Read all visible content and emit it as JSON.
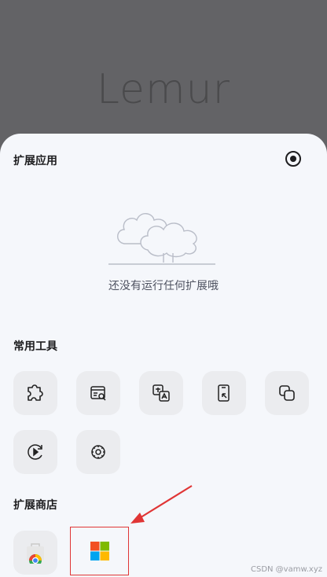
{
  "brand": {
    "text": "Lemur"
  },
  "extensions": {
    "title": "扩展应用",
    "settings_icon": "eye-settings-icon",
    "empty_text": "还没有运行任何扩展哦"
  },
  "tools": {
    "title": "常用工具",
    "items": [
      {
        "icon": "puzzle-icon"
      },
      {
        "icon": "page-search-icon"
      },
      {
        "icon": "translate-icon"
      },
      {
        "icon": "phone-pointer-icon"
      },
      {
        "icon": "copy-icon"
      },
      {
        "icon": "refresh-play-icon"
      },
      {
        "icon": "gear-icon"
      }
    ]
  },
  "store": {
    "title": "扩展商店",
    "items": [
      {
        "icon": "chrome-web-store-icon"
      },
      {
        "icon": "microsoft-store-icon"
      }
    ]
  },
  "annotation": {
    "color": "#e03535"
  },
  "watermark": "CSDN @vamw.xyz"
}
